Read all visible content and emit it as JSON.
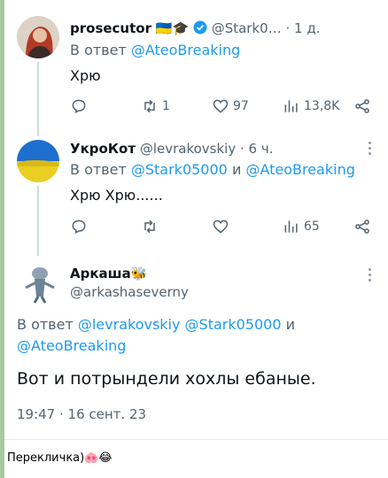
{
  "tweets": [
    {
      "name": "prosecutor",
      "name_emoji": "🇺🇦🎓",
      "handle": "@Stark0…",
      "sep": " · ",
      "time": "1 д.",
      "reply_prefix": "В ответ",
      "reply_users": "@AteoBreaking",
      "text": "Хрю",
      "retweets": "1",
      "likes": "97",
      "views": "13,8K"
    },
    {
      "name": "УкроКот",
      "handle": "@levrakovskiy",
      "sep": " · ",
      "time": "6 ч.",
      "reply_prefix": "В ответ",
      "reply_user_1": "@Stark05000",
      "reply_and": "и",
      "reply_user_2": "@AteoBreaking",
      "text": "Хрю Хрю......",
      "views": "65"
    },
    {
      "name": "Аркаша",
      "name_emoji": "🐝",
      "handle": "@arkashaseverny",
      "reply_prefix": "В ответ",
      "reply_line1_users": "@levrakovskiy @Stark05000",
      "reply_and": "и",
      "reply_line2_user": "@AteoBreaking",
      "text": "Вот и потрындели хохлы ебаные.",
      "timestamp": "19:47 · 16 сент. 23"
    }
  ],
  "caption": "Перекличка)🐽😂",
  "colors": {
    "accent": "#1d9bf0",
    "muted": "#536471",
    "verified": "#1d9bf0"
  },
  "icons": [
    "reply-icon",
    "retweet-icon",
    "like-icon",
    "views-icon",
    "share-icon",
    "verified-badge-icon",
    "more-icon"
  ]
}
